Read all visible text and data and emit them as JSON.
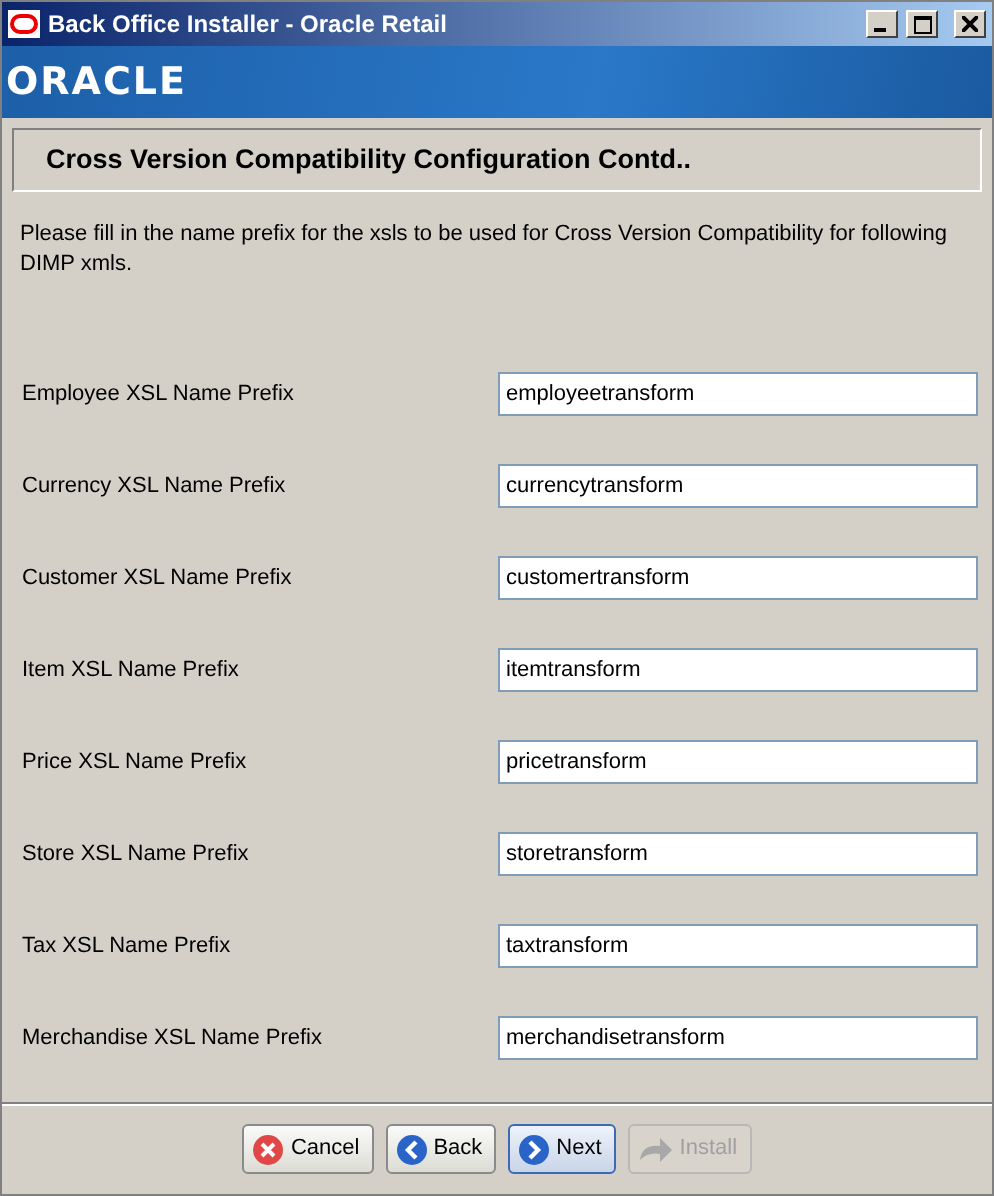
{
  "window": {
    "title": "Back Office Installer - Oracle Retail"
  },
  "banner": {
    "logo": "ORACLE"
  },
  "header": {
    "title": "Cross Version Compatibility Configuration Contd.."
  },
  "description": "Please fill in the name prefix for the xsls to be used for Cross Version Compatibility for following DIMP xmls.",
  "fields": [
    {
      "label": "Employee XSL Name Prefix",
      "value": "employeetransform"
    },
    {
      "label": "Currency XSL Name Prefix",
      "value": "currencytransform"
    },
    {
      "label": "Customer XSL Name Prefix",
      "value": "customertransform"
    },
    {
      "label": "Item XSL Name Prefix",
      "value": "itemtransform"
    },
    {
      "label": "Price XSL Name Prefix",
      "value": "pricetransform"
    },
    {
      "label": "Store XSL Name Prefix",
      "value": "storetransform"
    },
    {
      "label": "Tax XSL Name Prefix",
      "value": "taxtransform"
    },
    {
      "label": "Merchandise XSL Name Prefix",
      "value": "merchandisetransform"
    }
  ],
  "buttons": [
    {
      "kind": "cancel",
      "label": "Cancel",
      "disabled": false,
      "focused": false
    },
    {
      "kind": "back",
      "label": "Back",
      "disabled": false,
      "focused": false
    },
    {
      "kind": "next",
      "label": "Next",
      "disabled": false,
      "focused": true
    },
    {
      "kind": "install",
      "label": "Install",
      "disabled": true,
      "focused": false
    }
  ]
}
